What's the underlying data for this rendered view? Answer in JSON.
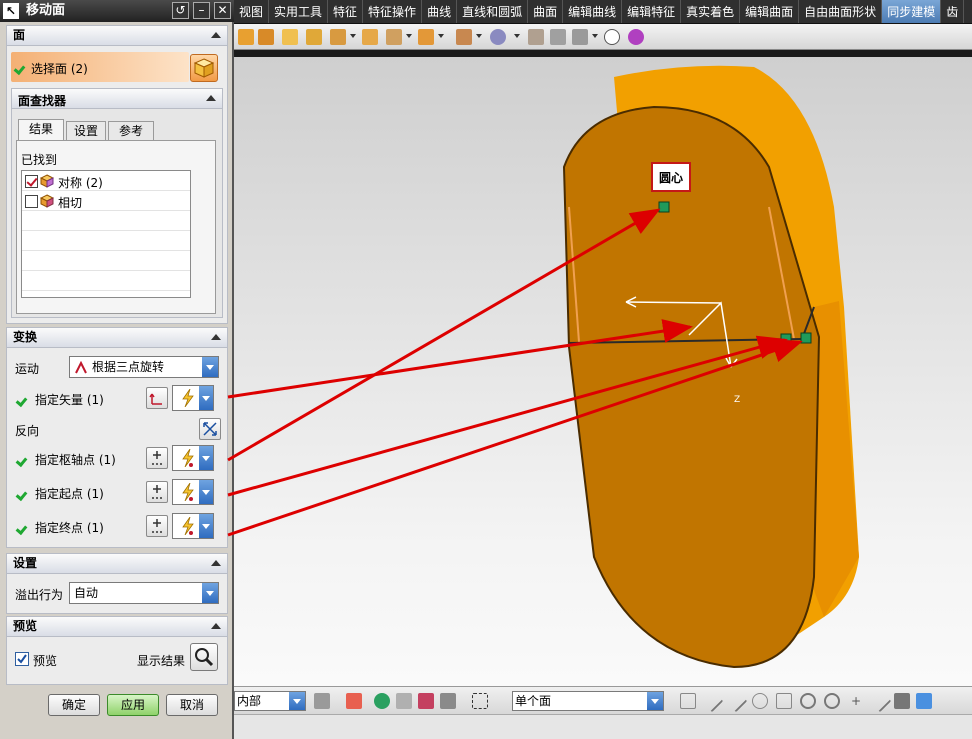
{
  "dialog": {
    "title": "移动面",
    "face_section": {
      "title": "面",
      "select_face_label": "选择面 (2)",
      "finder": {
        "title": "面查找器",
        "tabs": [
          "结果",
          "设置",
          "参考"
        ],
        "found_label": "已找到",
        "items": [
          {
            "label": "对称 (2)",
            "checked": true
          },
          {
            "label": "相切",
            "checked": false
          }
        ]
      }
    },
    "transform_section": {
      "title": "变换",
      "motion_label": "运动",
      "motion_value": "根据三点旋转",
      "vector_label": "指定矢量 (1)",
      "reverse_label": "反向",
      "pivot_label": "指定枢轴点 (1)",
      "start_label": "指定起点 (1)",
      "end_label": "指定终点 (1)"
    },
    "settings_section": {
      "title": "设置",
      "overflow_label": "溢出行为",
      "overflow_value": "自动"
    },
    "preview_section": {
      "title": "预览",
      "preview_label": "预览",
      "preview_checked": true,
      "show_result_label": "显示结果"
    },
    "buttons": {
      "ok": "确定",
      "apply": "应用",
      "cancel": "取消"
    }
  },
  "menubar": {
    "items": [
      "视图",
      "实用工具",
      "特征",
      "特征操作",
      "曲线",
      "直线和圆弧",
      "曲面",
      "编辑曲线",
      "编辑特征",
      "真实着色",
      "编辑曲面",
      "自由曲面形状",
      "同步建模",
      "齿"
    ],
    "active": "同步建模"
  },
  "viewport": {
    "annotation_label": "圆心",
    "axis_label": "Z"
  },
  "bottombar": {
    "filter_value": "内部",
    "selection_value": "单个面"
  },
  "colors": {
    "model_face": "#c07400",
    "model_side": "#f0a000",
    "arrow": "#dd0000",
    "menu_active": "#5a89c4"
  }
}
